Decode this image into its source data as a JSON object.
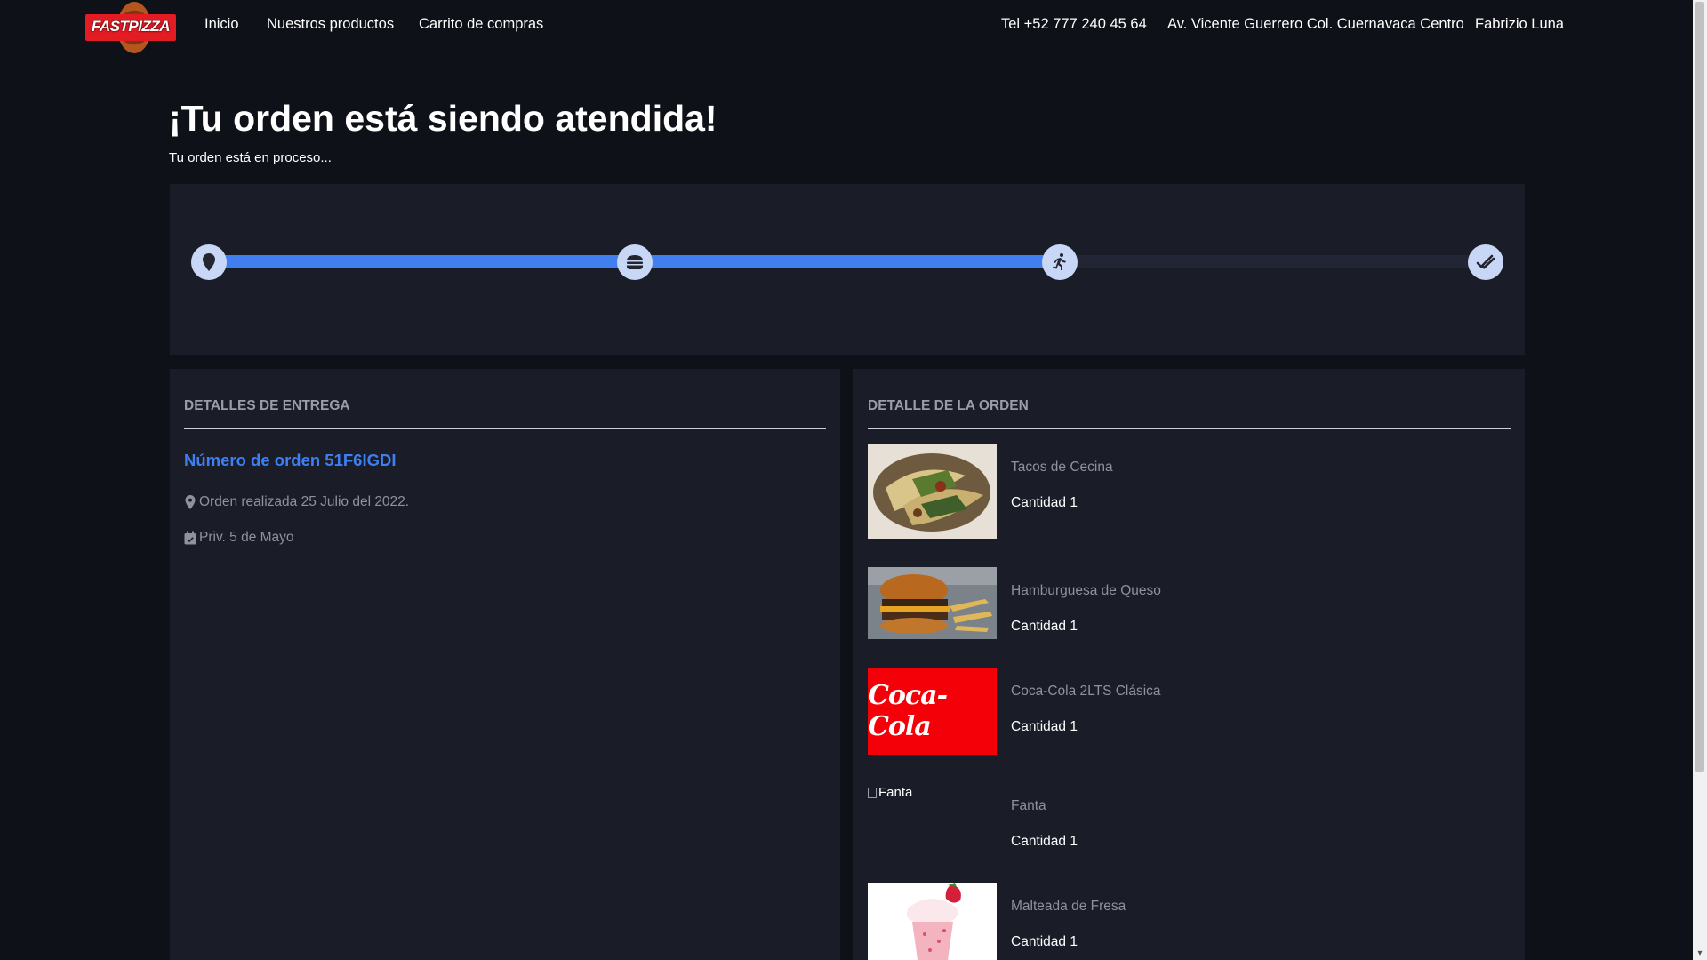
{
  "nav": {
    "logo_text": "FASTPIZZA",
    "links": [
      "Inicio",
      "Nuestros productos",
      "Carrito de compras"
    ],
    "phone": "Tel +52 777 240 45 64",
    "address": "Av. Vicente Guerrero Col. Cuernavaca Centro",
    "user": "Fabrizio Luna"
  },
  "header": {
    "title": "¡Tu orden está siendo atendida!",
    "subtitle": "Tu orden está en proceso..."
  },
  "progress": {
    "steps": [
      {
        "icon": "map-marker-icon"
      },
      {
        "icon": "hamburger-icon"
      },
      {
        "icon": "running-person-icon"
      },
      {
        "icon": "double-check-icon"
      }
    ],
    "completed_fraction": 0.667,
    "accent_color": "#3f7ff0",
    "step_color": "#c8d7f6"
  },
  "delivery": {
    "header": "DETALLES DE ENTREGA",
    "order_number": "Número de orden 51F6IGDI",
    "ordered_on": "Orden realizada 25 Julio del 2022.",
    "ordered_on_icon": "map-marker-icon",
    "address": "Priv. 5 de Mayo",
    "address_icon": "calendar-check-icon"
  },
  "order": {
    "header": "DETALLE DE LA ORDEN",
    "items": [
      {
        "name": "Tacos de Cecina",
        "qty": "Cantidad 1"
      },
      {
        "name": "Hamburguesa de Queso",
        "qty": "Cantidad 1"
      },
      {
        "name": "Coca-Cola 2LTS Clásica",
        "qty": "Cantidad 1",
        "logo_text": "Coca-Cola"
      },
      {
        "name": "Fanta",
        "qty": "Cantidad 1",
        "broken_alt": "Fanta"
      },
      {
        "name": "Malteada de Fresa",
        "qty": "Cantidad 1"
      }
    ]
  }
}
